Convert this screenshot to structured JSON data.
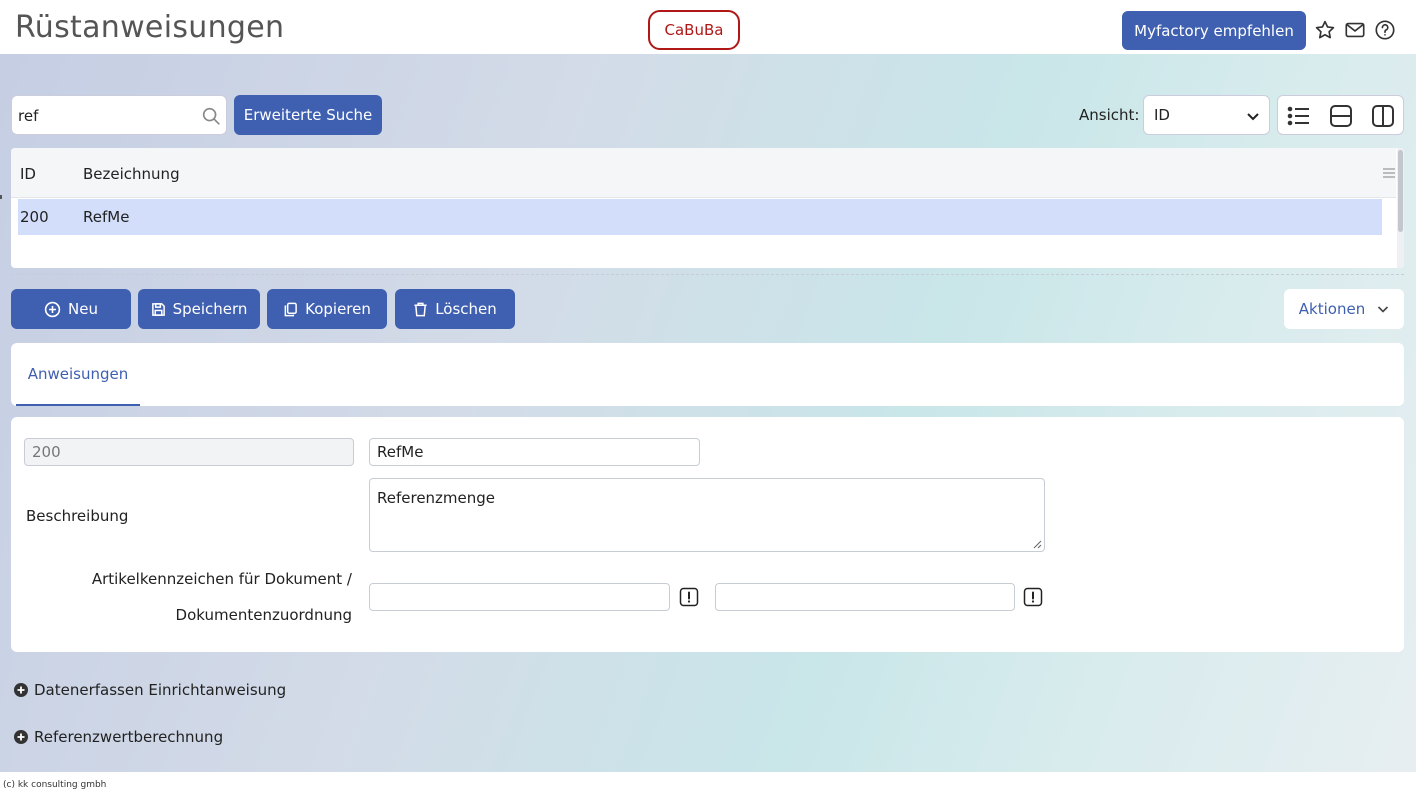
{
  "header": {
    "title": "Rüstanweisungen",
    "tenant": "CaBuBa",
    "recommend_label": "Myfactory empfehlen",
    "icons": [
      "star-icon",
      "mail-icon",
      "help-icon"
    ]
  },
  "search": {
    "value": "ref",
    "advanced_label": "Erweiterte Suche"
  },
  "view": {
    "label": "Ansicht:",
    "selected": "ID",
    "modes": [
      "list-view-icon",
      "split-horizontal-icon",
      "split-vertical-icon"
    ]
  },
  "grid": {
    "columns": [
      "ID",
      "Bezeichnung"
    ],
    "rows": [
      {
        "id": "200",
        "bezeichnung": "RefMe",
        "selected": true
      }
    ]
  },
  "toolbar": {
    "new_label": "Neu",
    "save_label": "Speichern",
    "copy_label": "Kopieren",
    "delete_label": "Löschen",
    "actions_label": "Aktionen"
  },
  "tabs": [
    {
      "label": "Anweisungen",
      "active": true
    }
  ],
  "form": {
    "id_value": "200",
    "name_value": "RefMe",
    "description_label": "Beschreibung",
    "description_value": "Referenzmenge",
    "article_label_line1": "Artikelkennzeichen für Dokument /",
    "article_label_line2": "Dokumentenzuordnung",
    "article_value_1": "",
    "article_value_2": ""
  },
  "sections": [
    {
      "label": "Datenerfassen Einrichtanweisung",
      "expanded": false
    },
    {
      "label": "Referenzwertberechnung",
      "expanded": false
    }
  ],
  "footer": {
    "text": "(c) kk consulting gmbh"
  },
  "colors": {
    "accent": "#3f5fb0",
    "tenant_red": "#b01818",
    "selected_row": "#d3defb"
  }
}
